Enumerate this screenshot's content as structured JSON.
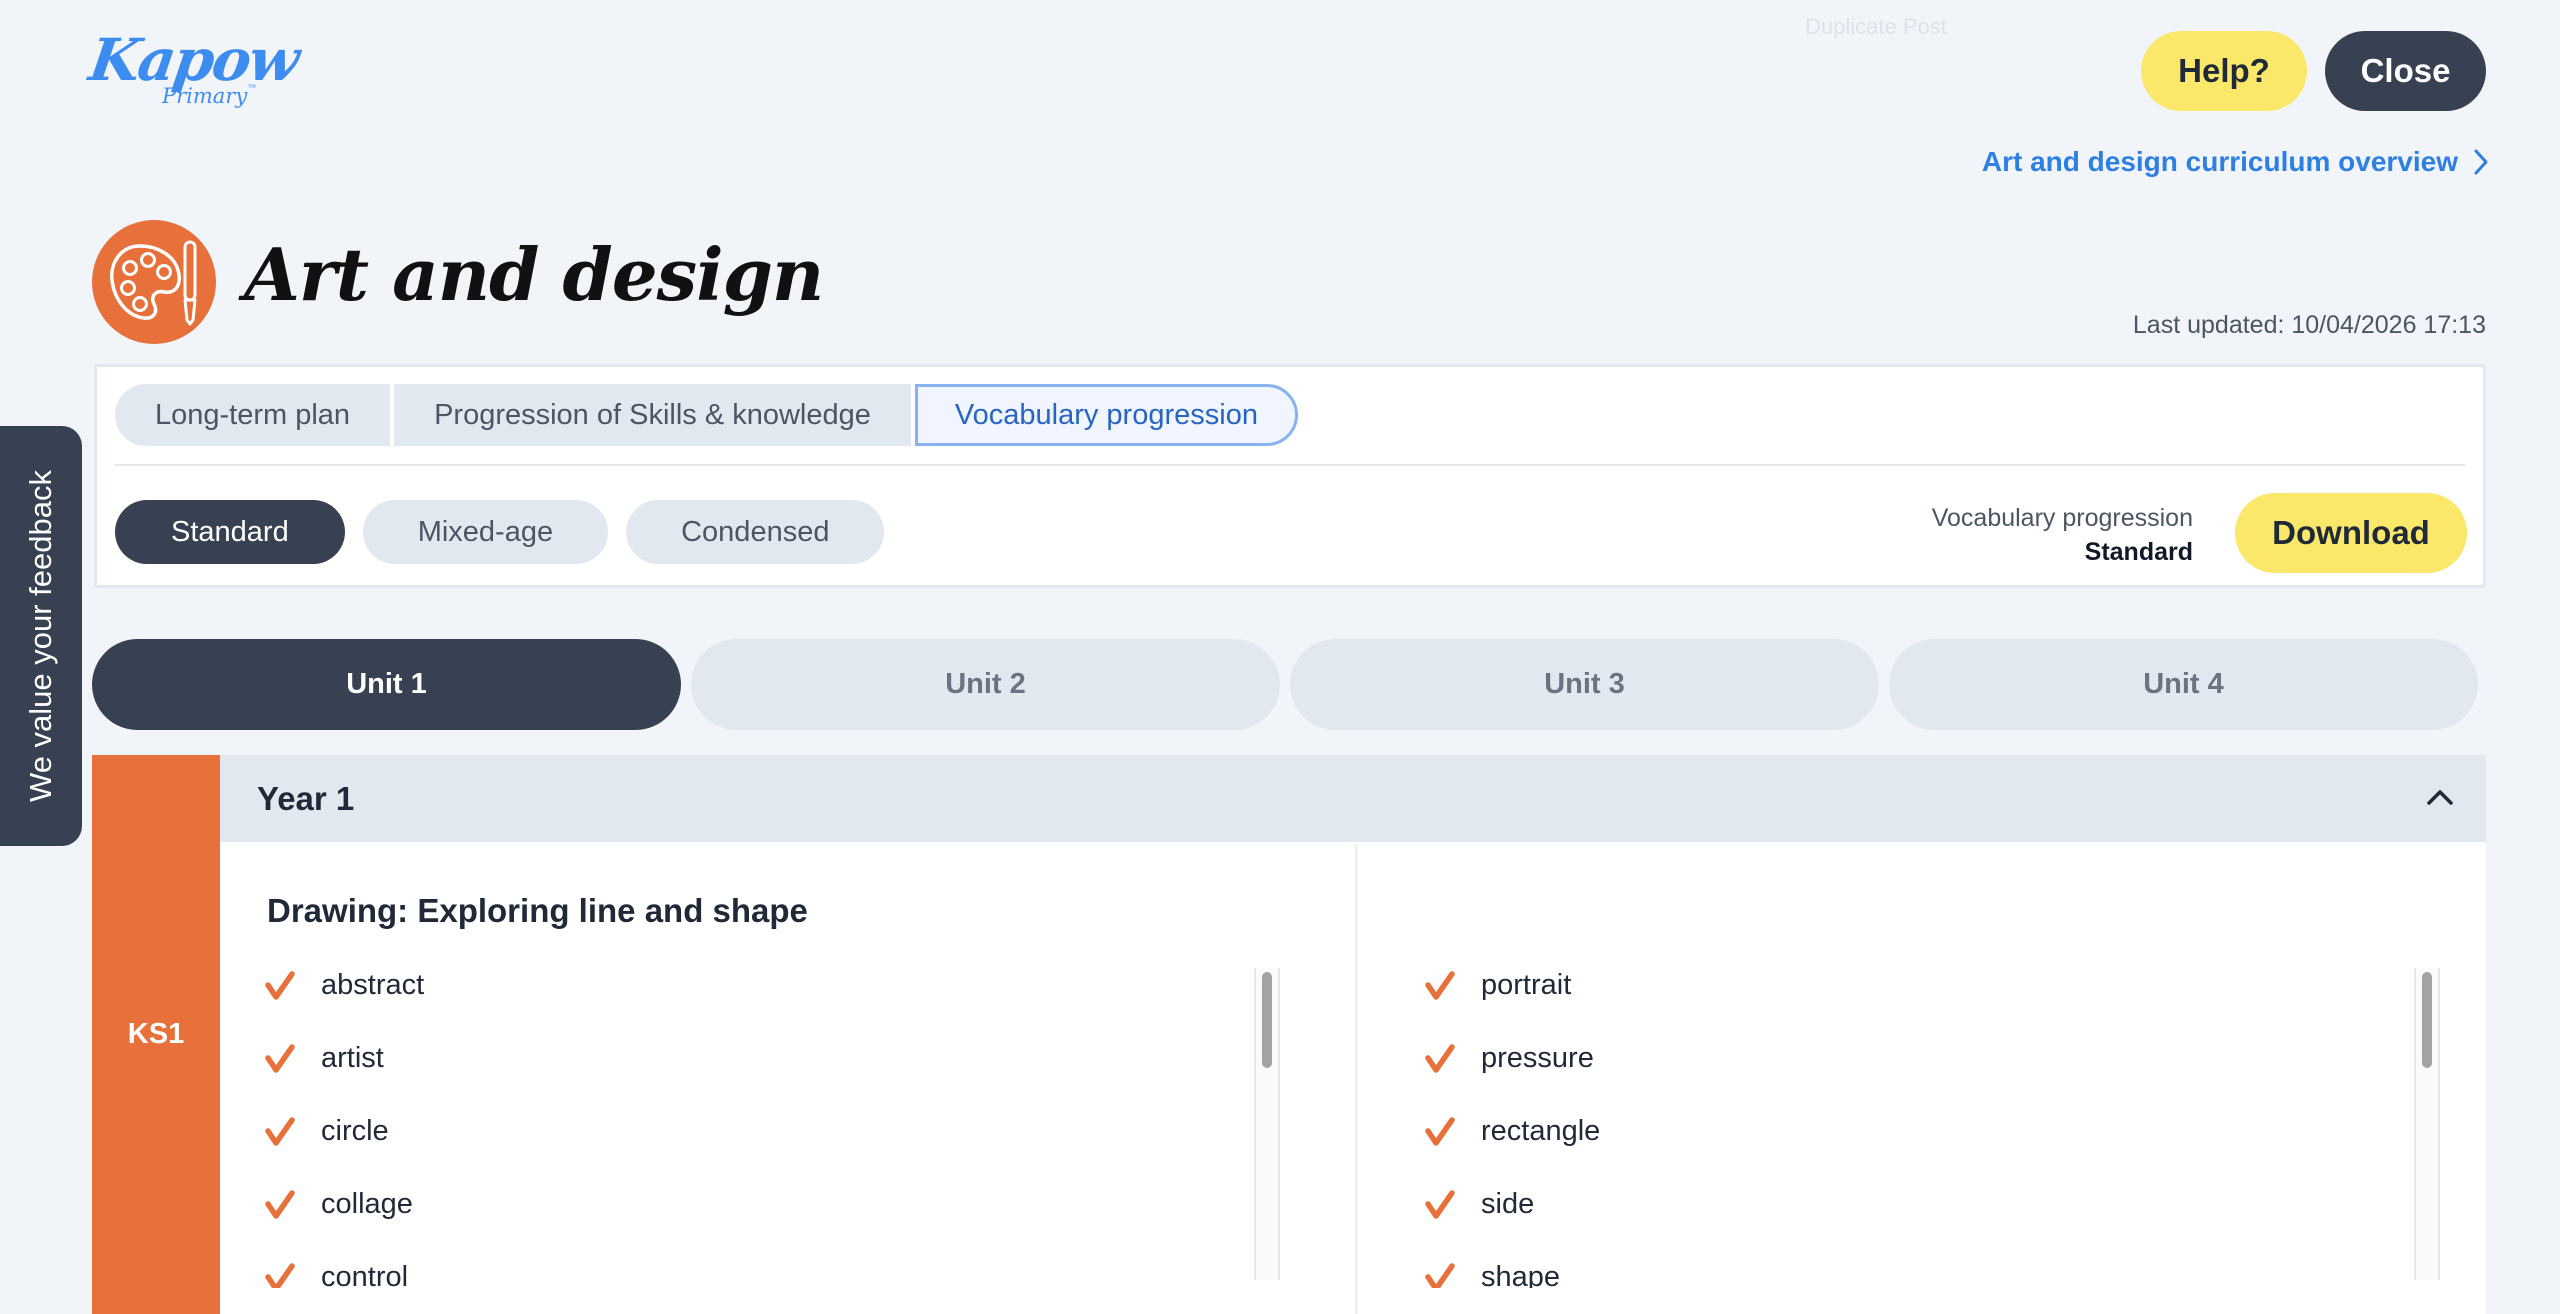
{
  "header": {
    "logo_main": "Kapow",
    "logo_sub": "Primary",
    "logo_tm": "™",
    "ghost_text": "Duplicate Post",
    "help_label": "Help?",
    "close_label": "Close",
    "overview_link": "Art and design curriculum overview",
    "overview_icon": "chevron-right-icon"
  },
  "subject": {
    "title": "Art and design",
    "icon": "palette-brush-icon",
    "last_updated": "Last updated: 10/04/2026 17:13"
  },
  "tabs": [
    {
      "label": "Long-term plan",
      "active": false
    },
    {
      "label": "Progression of Skills & knowledge",
      "active": false
    },
    {
      "label": "Vocabulary progression",
      "active": true
    }
  ],
  "variants": [
    {
      "label": "Standard",
      "active": true
    },
    {
      "label": "Mixed-age",
      "active": false
    },
    {
      "label": "Condensed",
      "active": false
    }
  ],
  "download": {
    "label": "Vocabulary progression",
    "value": "Standard",
    "button": "Download"
  },
  "units": [
    {
      "label": "Unit 1",
      "active": true
    },
    {
      "label": "Unit 2",
      "active": false
    },
    {
      "label": "Unit 3",
      "active": false
    },
    {
      "label": "Unit 4",
      "active": false
    }
  ],
  "key_stage": "KS1",
  "year": {
    "label": "Year 1",
    "expanded": true,
    "unit_title": "Drawing: Exploring line and shape",
    "left_words": [
      "abstract",
      "artist",
      "circle",
      "collage",
      "control"
    ],
    "right_words": [
      "portrait",
      "pressure",
      "rectangle",
      "side",
      "shape"
    ]
  },
  "feedback_label": "We value your feedback",
  "colors": {
    "accent_orange": "#e8703a",
    "dark": "#374151",
    "yellow": "#fbe76a",
    "link_blue": "#2d7fe3",
    "background": "#f1f5f9"
  }
}
